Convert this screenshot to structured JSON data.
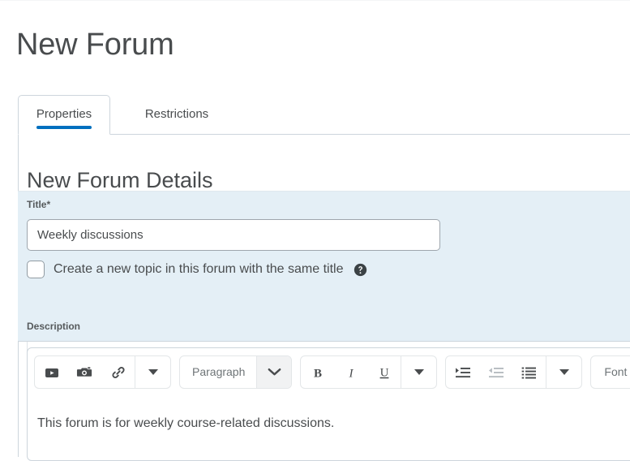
{
  "page": {
    "title": "New Forum"
  },
  "tabs": [
    {
      "label": "Properties",
      "active": true
    },
    {
      "label": "Restrictions",
      "active": false
    }
  ],
  "section": {
    "heading": "New Forum Details"
  },
  "form": {
    "title_field": {
      "label": "Title",
      "required_marker": "*",
      "value": "Weekly discussions",
      "placeholder": ""
    },
    "same_title_checkbox": {
      "label": "Create a new topic in this forum with the same title",
      "checked": false,
      "help_icon": "help-circle-icon"
    },
    "description_field": {
      "label": "Description"
    }
  },
  "editor": {
    "toolbar": {
      "group_insert": {
        "buttons": [
          {
            "icon": "insert-stuff-icon",
            "name": "insert-stuff-button"
          },
          {
            "icon": "camera-icon",
            "name": "insert-image-button"
          },
          {
            "icon": "link-icon",
            "name": "insert-link-button"
          }
        ],
        "overflow_icon": "caret-down-icon"
      },
      "format_select": {
        "value": "Paragraph",
        "arrow_icon": "chevron-down-icon"
      },
      "group_style": {
        "buttons": [
          {
            "icon": "bold-icon",
            "name": "bold-button",
            "label": "B"
          },
          {
            "icon": "italic-icon",
            "name": "italic-button",
            "label": "I"
          },
          {
            "icon": "underline-icon",
            "name": "underline-button",
            "label": "U"
          }
        ],
        "overflow_icon": "caret-down-icon"
      },
      "group_list": {
        "buttons": [
          {
            "icon": "indent-increase-icon",
            "name": "indent-button"
          },
          {
            "icon": "indent-decrease-icon",
            "name": "outdent-button"
          },
          {
            "icon": "unordered-list-icon",
            "name": "bulleted-list-button"
          }
        ],
        "overflow_icon": "caret-down-icon"
      },
      "font_select": {
        "value": "Font"
      }
    },
    "content": "This forum is for weekly course-related discussions."
  },
  "colors": {
    "accent": "#006fbf",
    "panel_highlight": "#e4eff6",
    "text": "#494c4e",
    "border": "#cdd5dc"
  }
}
